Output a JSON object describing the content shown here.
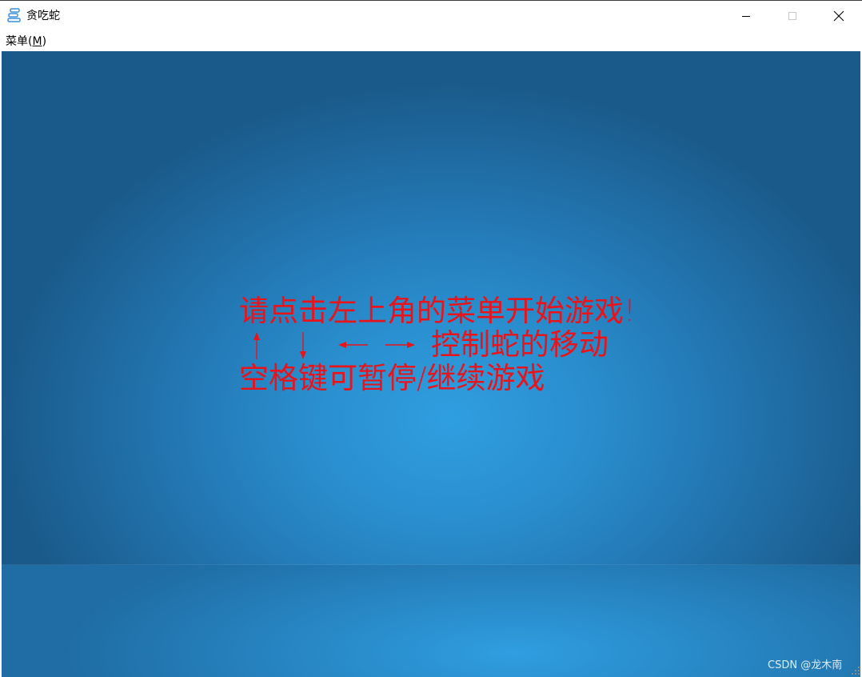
{
  "window": {
    "title": "贪吃蛇",
    "app_icon": "snake-app-icon"
  },
  "caption_buttons": {
    "minimize_icon": "minimize-icon",
    "maximize_icon": "maximize-icon",
    "close_icon": "close-icon"
  },
  "menubar": {
    "menu_label": "菜单(",
    "menu_accel": "M",
    "menu_suffix": ")"
  },
  "game": {
    "line1": "请点击左上角的菜单开始游戏!",
    "arrow_keys": [
      "↑",
      "↓",
      "←",
      "→"
    ],
    "line2": "控制蛇的移动",
    "line3": "空格键可暂停/继续游戏",
    "text_color": "#e8141b"
  },
  "watermark": "CSDN @龙木南",
  "colors": {
    "background_center": "#2f9ee0",
    "background_edge": "#1a5a8a"
  }
}
